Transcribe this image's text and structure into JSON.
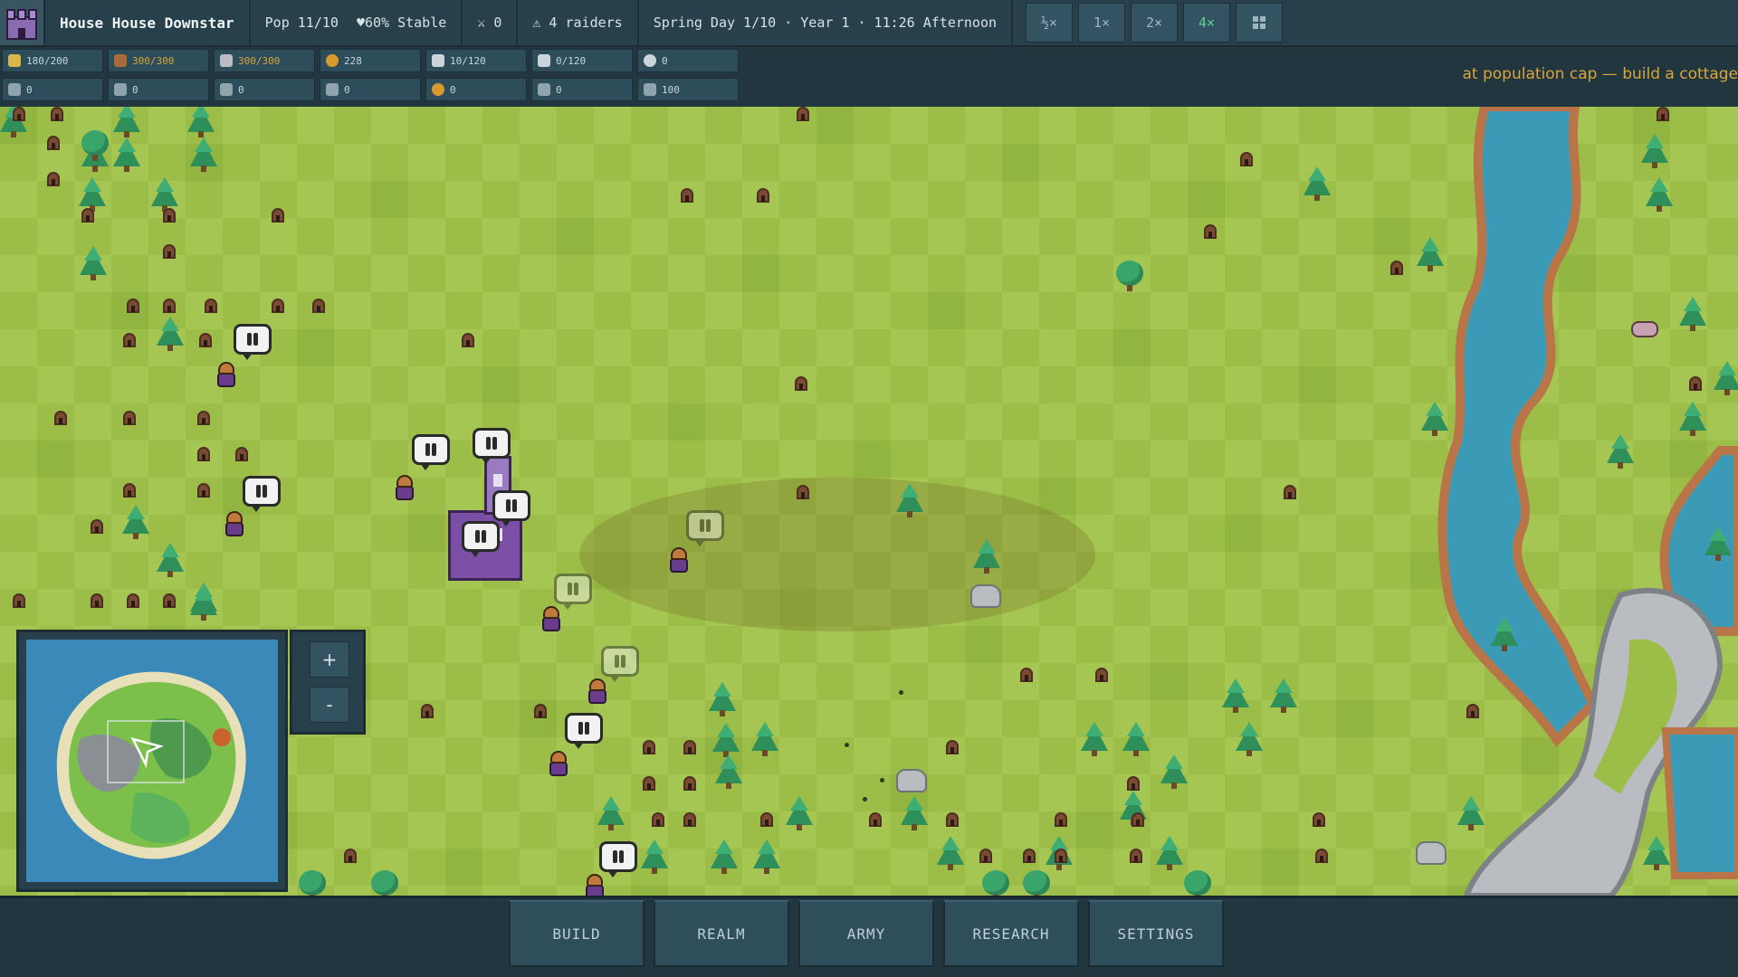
{
  "topbar": {
    "house_name": "House House Downstar",
    "population": "Pop 11/10",
    "stability": "♥60% Stable",
    "military": "⚔ 0",
    "raiders": "⚠ 4 raiders",
    "date": "Spring Day 1/10 · Year 1 · 11:26 Afternoon",
    "speeds": [
      "½×",
      "1×",
      "2×",
      "4×"
    ],
    "active_speed": "4×",
    "grid_icon": "grid-icon"
  },
  "resources": {
    "row1": [
      {
        "icon": "crown-icon",
        "value": "180/200",
        "capped": false,
        "color": "#d9b64a"
      },
      {
        "icon": "lumber-icon",
        "value": "300/300",
        "capped": true,
        "color": "#a86b3a"
      },
      {
        "icon": "stone-icon",
        "value": "300/300",
        "capped": true,
        "color": "#b9bcc0"
      },
      {
        "icon": "gold-icon",
        "value": "228",
        "capped": false,
        "color": "#d99a2b"
      },
      {
        "icon": "grain-icon",
        "value": "10/120",
        "capped": false,
        "color": "#c9d5da"
      },
      {
        "icon": "storage-icon",
        "value": "0/120",
        "capped": false,
        "color": "#c9d5da"
      },
      {
        "icon": "flask-icon",
        "value": "0",
        "capped": false,
        "color": "#c9d5da"
      }
    ],
    "row2": [
      {
        "icon": "tool-icon",
        "value": "0",
        "color": "#8fa4ad"
      },
      {
        "icon": "person-icon",
        "value": "0",
        "color": "#8fa4ad"
      },
      {
        "icon": "sword-icon",
        "value": "0",
        "color": "#8fa4ad"
      },
      {
        "icon": "bottle-icon",
        "value": "0",
        "color": "#8fa4ad"
      },
      {
        "icon": "orb-icon",
        "value": "0",
        "color": "#d99a2b"
      },
      {
        "icon": "shield-icon",
        "value": "0",
        "color": "#8fa4ad"
      },
      {
        "icon": "arrow-icon",
        "value": "100",
        "color": "#8fa4ad"
      }
    ]
  },
  "notice": "at population cap — build a cottage",
  "zoom": {
    "in_label": "+",
    "out_label": "-"
  },
  "menu": [
    "BUILD",
    "REALM",
    "ARMY",
    "RESEARCH",
    "SETTINGS"
  ],
  "colors": {
    "grass": "#9cbd47",
    "grass_light": "#a6c653",
    "water": "#3b9ab6",
    "riverbank": "#b97548",
    "ui_panel": "#27404b",
    "accent_active": "#5fd38a",
    "notice": "#d9a53a",
    "villager_robe": "#6a3c8c"
  }
}
